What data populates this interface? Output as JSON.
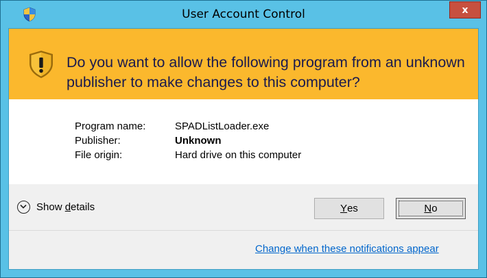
{
  "window": {
    "title": "User Account Control",
    "close_label": "x"
  },
  "banner": {
    "question": "Do you want to allow the following program from an unknown publisher to make changes to this computer?"
  },
  "details": {
    "rows": [
      {
        "label": "Program name:",
        "value": "SPADListLoader.exe",
        "bold": false
      },
      {
        "label": "Publisher:",
        "value": "Unknown",
        "bold": true
      },
      {
        "label": "File origin:",
        "value": "Hard drive on this computer",
        "bold": false
      }
    ]
  },
  "footer": {
    "show_details_prefix": "Show ",
    "show_details_access": "d",
    "show_details_suffix": "etails",
    "yes_access": "Y",
    "yes_rest": "es",
    "no_access": "N",
    "no_rest": "o",
    "link_text": "Change when these notifications appear"
  },
  "colors": {
    "titlebar": "#59c1e6",
    "banner": "#fbb82d",
    "close_button": "#c7503f",
    "link": "#0066cc",
    "question_text": "#1b1a4d"
  },
  "icons": [
    "uac-shield-icon",
    "warning-shield-icon",
    "close-icon",
    "chevron-down-icon"
  ]
}
